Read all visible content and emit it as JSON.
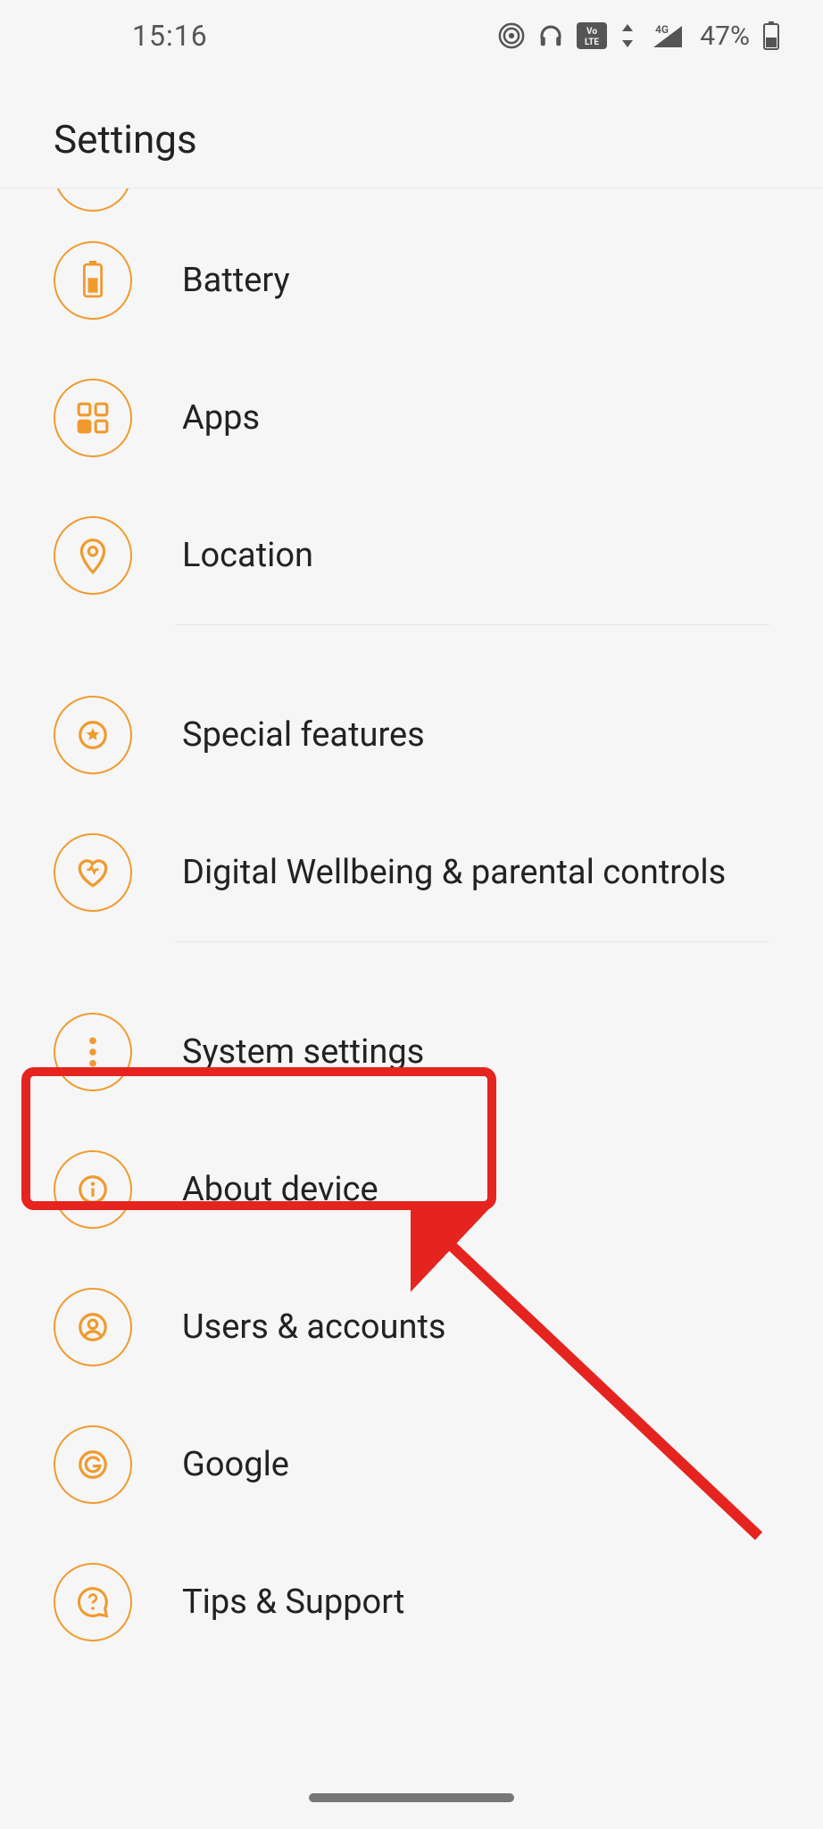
{
  "status": {
    "time": "15:16",
    "battery_text": "47%",
    "network_badge": "Vo LTE",
    "signal_sub": "4G"
  },
  "header": {
    "title": "Settings"
  },
  "items": {
    "battery": {
      "label": "Battery"
    },
    "apps": {
      "label": "Apps"
    },
    "location": {
      "label": "Location"
    },
    "special": {
      "label": "Special features"
    },
    "wellbeing": {
      "label": "Digital Wellbeing & parental controls"
    },
    "system": {
      "label": "System settings"
    },
    "about": {
      "label": "About device"
    },
    "users": {
      "label": "Users & accounts"
    },
    "google": {
      "label": "Google"
    },
    "tips": {
      "label": "Tips & Support"
    }
  },
  "colors": {
    "accent": "#f09a2e",
    "highlight": "#e52420"
  },
  "annotation": {
    "target": "system"
  }
}
